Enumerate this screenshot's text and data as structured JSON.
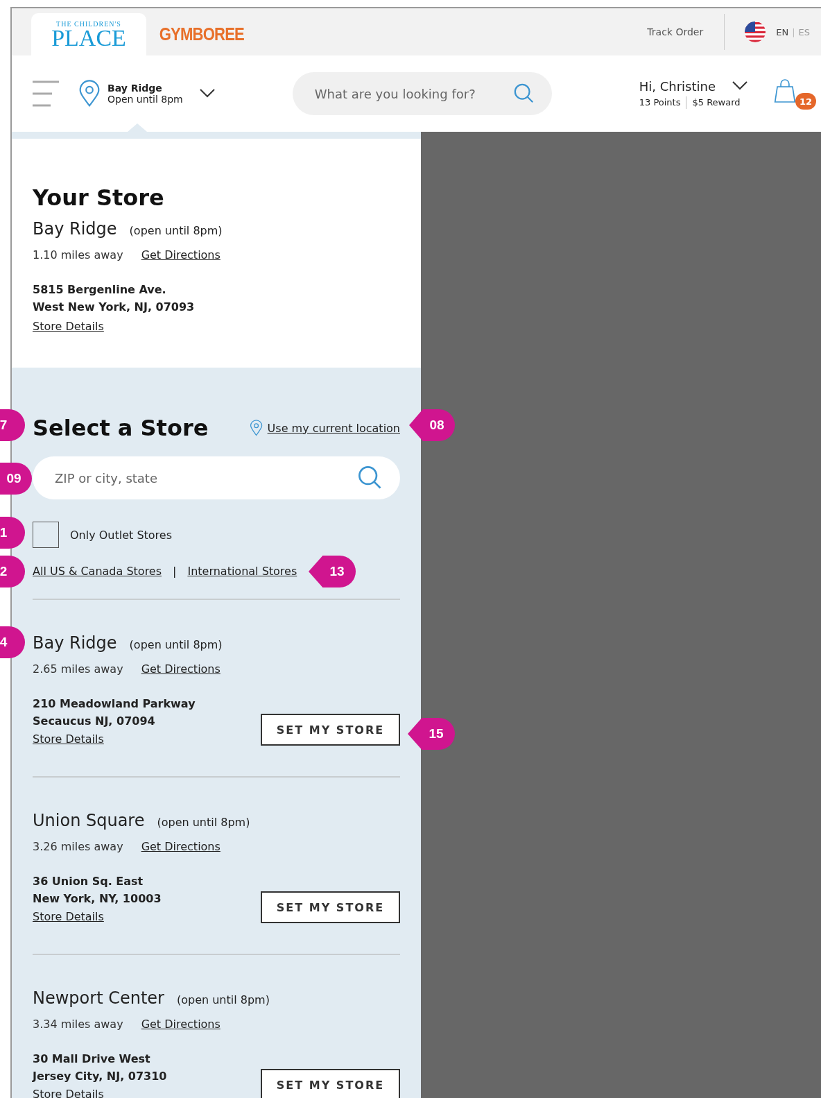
{
  "top_bar": {
    "brands": [
      {
        "kind": "tcp",
        "line1": "THE CHILDREN'S",
        "line2": "PLACE",
        "selected": true
      },
      {
        "kind": "gym",
        "line1": "GYMBOREE",
        "selected": false
      }
    ],
    "track_order": "Track Order",
    "lang_separator": "|",
    "languages": [
      {
        "label": "EN",
        "selected": true
      },
      {
        "label": "ES",
        "selected": false
      }
    ]
  },
  "nav": {
    "store_name": "Bay Ridge",
    "store_hours": "Open until 8pm",
    "search": {
      "placeholder": "What are you looking for?"
    },
    "greeting": "Hi, Christine",
    "points": "13 Points",
    "reward": "$5 Reward",
    "cart_count": "12"
  },
  "your_store": {
    "title": "Your Store",
    "name": "Bay Ridge",
    "hours": "(open until 8pm)",
    "distance": "1.10 miles away",
    "directions": "Get Directions",
    "address": [
      "5815 Bergenline Ave.",
      "West New York, NJ, 07093"
    ],
    "details": "Store Details"
  },
  "select_store": {
    "title": "Select a Store",
    "use_location": "Use my current location",
    "search": {
      "placeholder": "ZIP or city, state"
    },
    "outlet": {
      "label": "Only Outlet Stores",
      "checked": false
    },
    "links": [
      "All US & Canada Stores",
      "International Stores"
    ],
    "separator": "|",
    "stores": [
      {
        "name": "Bay Ridge",
        "hours": "(open until 8pm)",
        "distance": "2.65 miles away",
        "directions": "Get Directions",
        "address": [
          "210 Meadowland Parkway",
          "Secaucus NJ, 07094"
        ],
        "details": "Store Details",
        "button": "SET MY STORE"
      },
      {
        "name": "Union Square",
        "hours": "(open until 8pm)",
        "distance": "3.26 miles away",
        "directions": "Get Directions",
        "address": [
          "36 Union Sq. East",
          "New York, NY, 10003"
        ],
        "details": "Store Details",
        "button": "SET MY STORE"
      },
      {
        "name": "Newport Center",
        "hours": "(open until 8pm)",
        "distance": "3.34 miles away",
        "directions": "Get Directions",
        "address": [
          "30 Mall Drive West",
          "Jersey City, NJ, 07310"
        ],
        "details": "Store Details",
        "button": "SET MY STORE"
      }
    ]
  },
  "annotations": [
    {
      "label": "7"
    },
    {
      "label": "08"
    },
    {
      "label": "09"
    },
    {
      "label": "1"
    },
    {
      "label": "2"
    },
    {
      "label": "13"
    },
    {
      "label": "4"
    },
    {
      "label": "15"
    }
  ]
}
